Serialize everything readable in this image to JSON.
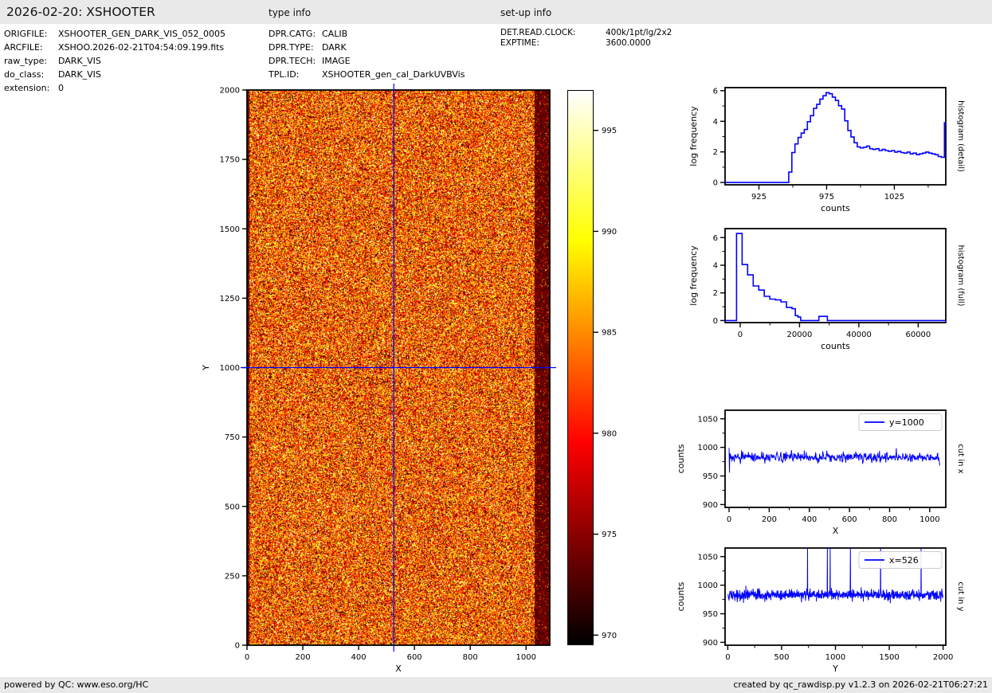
{
  "header": {
    "title": "2026-02-20: XSHOOTER",
    "sections": {
      "type_info": "type info",
      "setup_info": "set-up info"
    },
    "file_info": [
      {
        "label": "ORIGFILE:",
        "value": "XSHOOTER_GEN_DARK_VIS_052_0005"
      },
      {
        "label": "ARCFILE:",
        "value": "XSHOO.2026-02-21T04:54:09.199.fits"
      },
      {
        "label": "raw_type:",
        "value": "DARK_VIS"
      },
      {
        "label": "do_class:",
        "value": "DARK_VIS"
      },
      {
        "label": "extension:",
        "value": "0"
      }
    ],
    "type_info": [
      {
        "label": "DPR.CATG:",
        "value": "CALIB"
      },
      {
        "label": "DPR.TYPE:",
        "value": "DARK"
      },
      {
        "label": "DPR.TECH:",
        "value": "IMAGE"
      },
      {
        "label": "TPL.ID:",
        "value": "XSHOOTER_gen_cal_DarkUVBVis"
      }
    ],
    "setup_info": [
      {
        "label": "DET.READ.CLOCK:",
        "value": "400k/1pt/lg/2x2"
      },
      {
        "label": "EXPTIME:",
        "value": "3600.0000"
      }
    ]
  },
  "footer": {
    "left": "powered by QC: www.eso.org/HC",
    "right": "created by qc_rawdisp.py v1.2.3 on 2026-02-21T06:27:21"
  },
  "colors": {
    "accent_blue": "#0000ff",
    "bar_bg": "#e9e9e9",
    "frame": "#000000"
  },
  "chart_data": [
    {
      "type": "heatmap",
      "name": "raw-dark-frame-image",
      "xlabel": "X",
      "ylabel": "Y",
      "xlim": [
        0,
        1085
      ],
      "ylim": [
        0,
        2000
      ],
      "xticks": [
        0,
        200,
        400,
        600,
        800,
        1000
      ],
      "yticks": [
        0,
        250,
        500,
        750,
        1000,
        1250,
        1500,
        1750,
        2000
      ],
      "value_mean": 983,
      "value_sigma": 6.5,
      "color_range": [
        969.5,
        997
      ],
      "colormap": "hot",
      "colorbar_ticks": [
        970,
        975,
        980,
        985,
        990,
        995
      ],
      "crosshair": {
        "x": 526,
        "y": 1000
      },
      "dark_bands_x": [
        [
          0,
          8
        ],
        [
          1028,
          1085
        ]
      ]
    },
    {
      "type": "line",
      "style": "step",
      "right_label": "histogram (detail)",
      "xlabel": "counts",
      "ylabel": "log frequency",
      "xlim": [
        900,
        1063
      ],
      "ylim": [
        -0.15,
        6.2
      ],
      "xticks": [
        925,
        975,
        1025
      ],
      "xminor": [
        950,
        1000,
        1050
      ],
      "yticks": [
        0,
        2,
        4,
        6
      ],
      "yminor": [
        1,
        3,
        5
      ],
      "steps": [
        [
          900,
          0
        ],
        [
          947,
          0.68
        ],
        [
          949.3,
          1.96
        ],
        [
          951.6,
          2.52
        ],
        [
          953.9,
          2.94
        ],
        [
          956.2,
          3.23
        ],
        [
          958.5,
          3.46
        ],
        [
          960.8,
          3.97
        ],
        [
          963.1,
          4.37
        ],
        [
          965.4,
          4.85
        ],
        [
          967.7,
          5.11
        ],
        [
          970,
          5.45
        ],
        [
          972.3,
          5.67
        ],
        [
          974.6,
          5.87
        ],
        [
          976.9,
          5.8
        ],
        [
          979.2,
          5.58
        ],
        [
          981.5,
          5.36
        ],
        [
          983.8,
          5.02
        ],
        [
          986.1,
          4.8
        ],
        [
          988.4,
          4.03
        ],
        [
          990.7,
          3.4
        ],
        [
          993,
          2.98
        ],
        [
          995.3,
          2.6
        ],
        [
          997.6,
          2.33
        ],
        [
          999.9,
          2.26
        ],
        [
          1002.2,
          2.3
        ],
        [
          1004.5,
          2.38
        ],
        [
          1006.8,
          2.21
        ],
        [
          1009.1,
          2.16
        ],
        [
          1011.4,
          2.21
        ],
        [
          1013.7,
          2.09
        ],
        [
          1016,
          2.16
        ],
        [
          1018.3,
          2.09
        ],
        [
          1020.6,
          2.04
        ],
        [
          1022.9,
          2.09
        ],
        [
          1025.2,
          1.99
        ],
        [
          1027.5,
          2.04
        ],
        [
          1029.8,
          1.96
        ],
        [
          1032.1,
          1.92
        ],
        [
          1034.4,
          1.99
        ],
        [
          1036.7,
          1.87
        ],
        [
          1039,
          1.92
        ],
        [
          1041.3,
          1.82
        ],
        [
          1043.6,
          1.87
        ],
        [
          1045.9,
          1.92
        ],
        [
          1048.2,
          1.99
        ],
        [
          1050.5,
          1.92
        ],
        [
          1052.8,
          1.87
        ],
        [
          1055.1,
          1.82
        ],
        [
          1057.4,
          1.7
        ],
        [
          1059.7,
          1.65
        ],
        [
          1062,
          3.91
        ]
      ],
      "end_x": 1063
    },
    {
      "type": "line",
      "style": "step",
      "right_label": "histogram (full)",
      "xlabel": "counts",
      "ylabel": "log frequency",
      "xlim": [
        -5100,
        69300
      ],
      "ylim": [
        -0.15,
        6.65
      ],
      "xticks": [
        0,
        20000,
        40000,
        60000
      ],
      "xminor": [
        10000,
        30000,
        50000
      ],
      "yticks": [
        0,
        2,
        4,
        6
      ],
      "yminor": [
        1,
        3,
        5
      ],
      "steps": [
        [
          -5100,
          0
        ],
        [
          -1230,
          6.3
        ],
        [
          640,
          4.05
        ],
        [
          2510,
          3.3
        ],
        [
          4380,
          2.5
        ],
        [
          6250,
          2.2
        ],
        [
          8120,
          1.75
        ],
        [
          9990,
          1.55
        ],
        [
          11860,
          1.5
        ],
        [
          13730,
          1.35
        ],
        [
          15600,
          0.95
        ],
        [
          17470,
          0.85
        ],
        [
          18600,
          0.35
        ],
        [
          19500,
          0.25
        ],
        [
          20400,
          0
        ],
        [
          26500,
          0.3
        ],
        [
          29400,
          0
        ]
      ],
      "end_x": 69300
    },
    {
      "type": "line",
      "right_label": "cut in x",
      "legend": "y=1000",
      "xlabel": "X",
      "ylabel": "counts",
      "xlim": [
        -20,
        1080
      ],
      "ylim": [
        895,
        1065
      ],
      "xticks": [
        0,
        200,
        400,
        600,
        800,
        1000
      ],
      "xminor": [
        100,
        300,
        500,
        700,
        900
      ],
      "yticks": [
        900,
        950,
        1000,
        1050
      ],
      "yminor": [
        925,
        975,
        1025
      ],
      "signal": {
        "mean": 983,
        "sigma": 4.5,
        "n": 525,
        "x_range": [
          0,
          1050
        ],
        "start_spike": [
          999,
          956
        ],
        "end_dip": 968
      }
    },
    {
      "type": "line",
      "right_label": "cut in y",
      "legend": "x=526",
      "xlabel": "Y",
      "ylabel": "counts",
      "xlim": [
        -25,
        2025
      ],
      "ylim": [
        895,
        1065
      ],
      "xticks": [
        0,
        500,
        1000,
        1500,
        2000
      ],
      "xminor": [
        250,
        750,
        1250,
        1750
      ],
      "yticks": [
        900,
        950,
        1000,
        1050
      ],
      "yminor": [
        925,
        975,
        1025
      ],
      "signal": {
        "mean": 983,
        "sigma": 4.5,
        "n": 1000,
        "x_range": [
          0,
          2000
        ],
        "spikes_x": [
          740,
          925,
          950,
          1140,
          1420,
          1795
        ]
      }
    }
  ]
}
